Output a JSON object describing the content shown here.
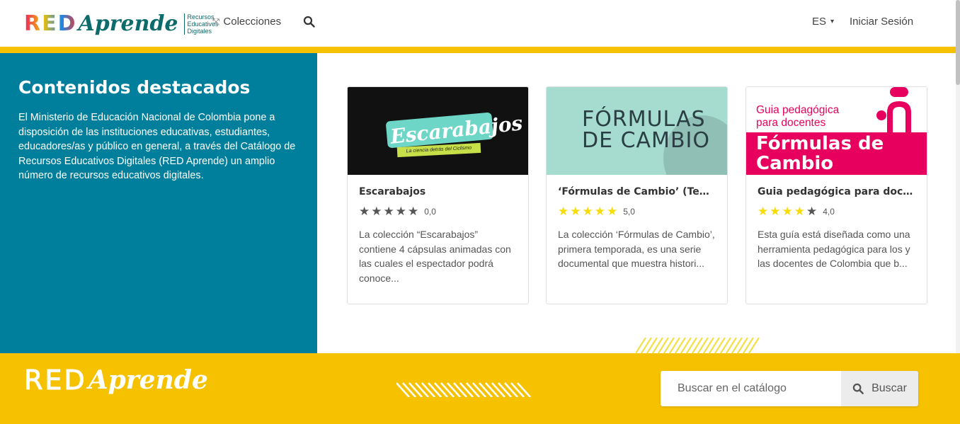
{
  "header": {
    "logo": {
      "red": "RED",
      "aprende": "Aprende",
      "subtitle": "Recursos Educativos Digitales"
    },
    "nav_colecciones": "Colecciones",
    "lang": "ES",
    "login": "Iniciar Sesión"
  },
  "featured": {
    "title": "Contenidos destacados",
    "text": "El Ministerio de Educación Nacional de Colombia pone a disposición de las instituciones educativas, estudiantes, educadores/as y público en general, a través del Catálogo de Recursos Educativos Digitales (RED Aprende) un amplio número de recursos educativos digitales."
  },
  "cards": [
    {
      "title": "Escarabajos",
      "rating": 0,
      "score_label": "0,0",
      "description": "La colección “Escarabajos” contiene 4 cápsulas animadas con las cuales el espectador podrá conoce...",
      "thumb": {
        "line1": "Escarabajos",
        "line2": "La ciencia detrás del Ciclismo"
      }
    },
    {
      "title": "‘Fórmulas de Cambio’ (Tem...",
      "rating": 5,
      "score_label": "5,0",
      "description": "La colección ‘Fórmulas de Cambio’, primera temporada, es una serie documental que muestra histori...",
      "thumb": {
        "line1": "FÓRMULAS",
        "line2": "DE CAMBIO"
      }
    },
    {
      "title": "Guia pedagógica para docen...",
      "rating": 4,
      "score_label": "4,0",
      "description": "Esta guía está diseñada como una herramienta pedagógica para los y las docentes de Colombia que b...",
      "thumb": {
        "line1": "Guia pedagógica para docentes",
        "line2": "Fórmulas de Cambio"
      }
    }
  ],
  "footer": {
    "logo": {
      "red": "RED",
      "aprende": "Aprende"
    },
    "search_placeholder": "Buscar en el catálogo",
    "search_button": "Buscar"
  },
  "colors": {
    "teal": "#007f9c",
    "yellow": "#f6c200",
    "star": "#f8dc07",
    "pink": "#e8005e",
    "brand_green": "#0e6b6b"
  },
  "icons": {
    "colecciones": "collapse-arrows-icon",
    "search": "search-icon",
    "lang_chevron": "chevron-down-icon",
    "star": "star-icon"
  }
}
